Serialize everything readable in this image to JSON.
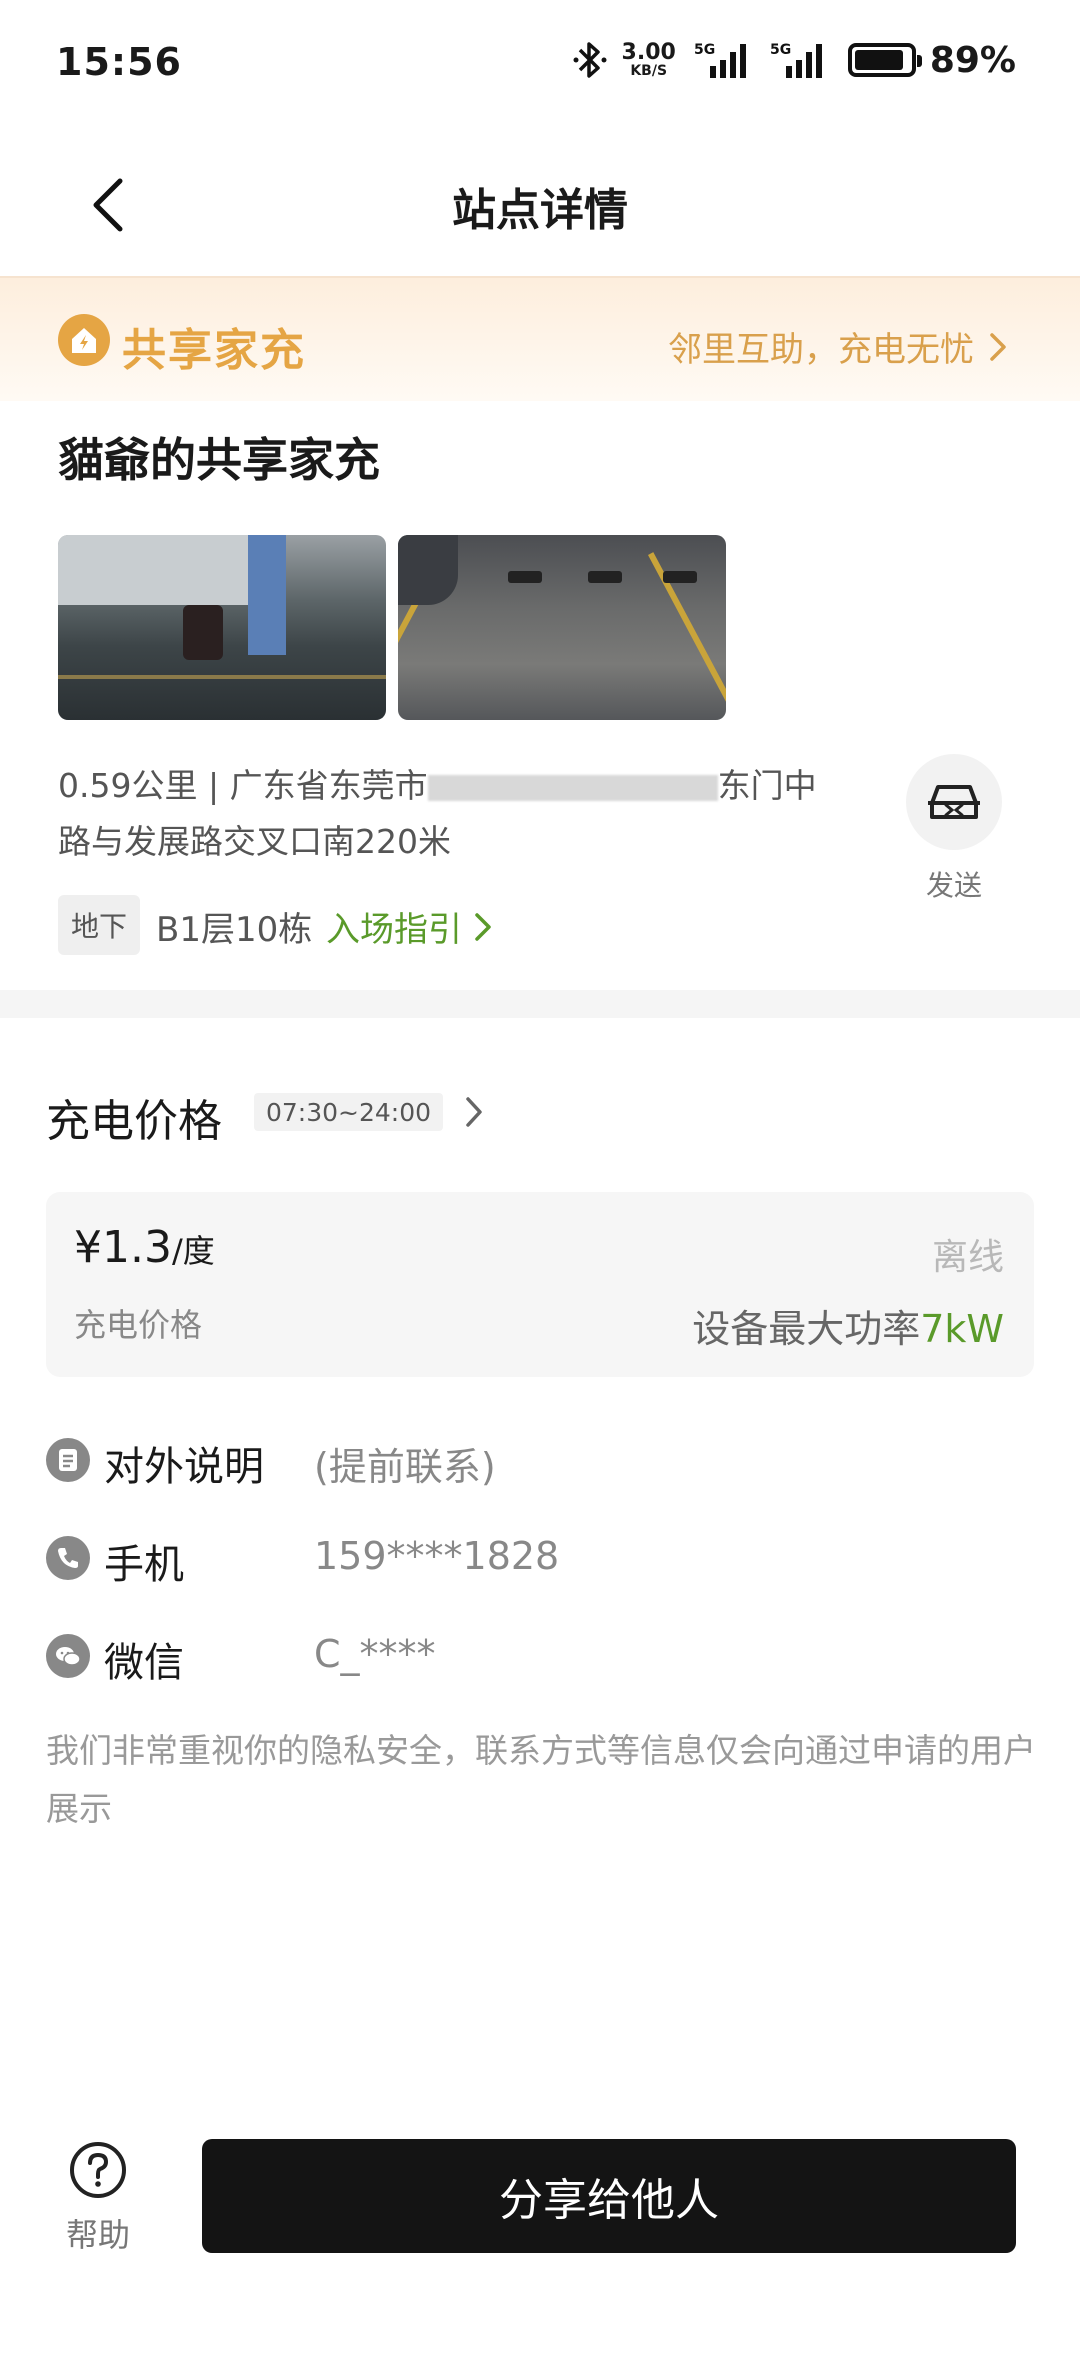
{
  "status_bar": {
    "time": "15:56",
    "net_speed_value": "3.00",
    "net_speed_unit": "KB/S",
    "sim1": "5G",
    "sim2": "5G",
    "battery": "89%",
    "battery_level": 0.89
  },
  "nav": {
    "title": "站点详情"
  },
  "banner": {
    "title": "共享家充",
    "link": "邻里互助，充电无忧"
  },
  "station": {
    "name": "貓爺的共享家充",
    "address_line1_start": "0.59公里 | 广东省东莞市",
    "address_line1_end": "东门中",
    "address_line2": "路与发展路交叉口南220米",
    "send_label": "发送",
    "floor_tag": "地下",
    "floor_text": "B1层10栋",
    "guide_link": "入场指引"
  },
  "price": {
    "title": "充电价格",
    "time_range": "07:30~24:00",
    "value": "¥1.3",
    "unit": "/度",
    "label": "充电价格",
    "status": "离线",
    "max_power_label": "设备最大功率",
    "max_power_value": "7kW"
  },
  "contacts": [
    {
      "label": "对外说明",
      "value": "(提前联系)",
      "icon": "document-icon"
    },
    {
      "label": "手机",
      "value": "159****1828",
      "icon": "phone-icon"
    },
    {
      "label": "微信",
      "value": "C_****",
      "icon": "wechat-icon"
    }
  ],
  "privacy_note": "我们非常重视你的隐私安全，联系方式等信息仅会向通过申请的用户展示",
  "bottom": {
    "help_label": "帮助",
    "share_label": "分享给他人"
  },
  "colors": {
    "accent_gold": "#e5a544",
    "accent_green": "#5a9a2a",
    "primary_button": "#141414"
  }
}
